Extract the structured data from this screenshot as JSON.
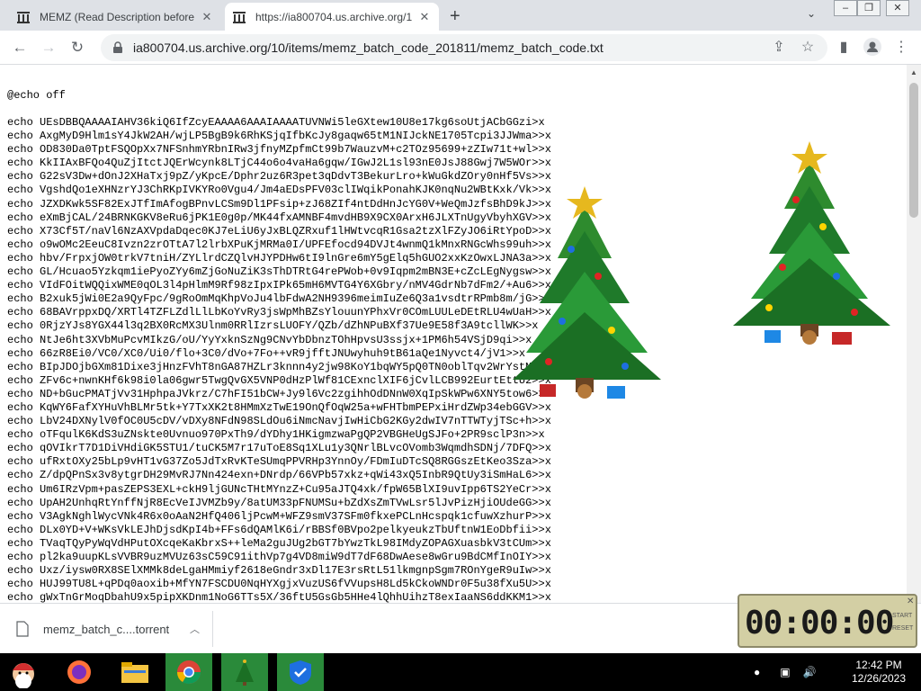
{
  "tabs": [
    {
      "title": "MEMZ (Read Description before",
      "icon": "archive-icon"
    },
    {
      "title": "https://ia800704.us.archive.org/1",
      "icon": "archive-icon"
    }
  ],
  "address_bar": {
    "url": "ia800704.us.archive.org/10/items/memz_batch_code_201811/memz_batch_code.txt"
  },
  "content": {
    "first_line": "@echo off",
    "lines": [
      "echo UEsDBBQAAAAIAHV36kiQ6IfZcyEAAAA6AAAIAAAATUVNWi5leGXtew10U8e17kg6soUtjACbGGzi>x",
      "echo AxgMyD9Hlm1sY4JkW2AH/wjLP5BgB9k6RhKSjqIfbKcJy8gaqw65tM1NIJckNE1705Tcpi3JJWma>>x",
      "echo OD830Da0TptFSQOpXx7NFSnhmYRbnIRw3jfnyMZpfmCt99b7WauzvM+c2TOz95699+zZIw71t+wl>>x",
      "echo KkIIAxBFQo4QuZjItctJQErWcynk8LTjC44o6o4vaHa6gqw/IGwJ2L1sl93nE0JsJ88Gwj7W5WOr>>x",
      "echo G22sV3Dw+dOnJ2XHaTxj9pZ/yKpcE/Dphr2uz6R3pet3qDdvT3BekurLro+kWuGkdZOry0nHf5Vs>>x",
      "echo VgshdQo1eXHNzrYJ3ChRKpIVKYRo0Vgu4/Jm4aEDsPFV03clIWqikPonahKJK0nqNu2WBtKxk/Vk>>x",
      "echo JZXDKwk5SF82ExJTfImAfogBPnvLCSm9Dl1PFsip+zJ68ZIf4ntDdHnJcYG0V+WeQmJzfsBhD9kJ>>x",
      "echo eXmBjCAL/24BRNKGKV8eRu6jPK1E0g0p/MK44fxAMNBF4mvdHB9X9CX0ArxH6JLXTnUgyVbyhXGV>>x",
      "echo X73Cf5T/naVl6NzAXVpdaDqec0KJ7eLiU6yJxBLQZRxuf1lHWtvcqR1Gsa2tzXlFZyJO6iRtYpoD>>x",
      "echo o9wOMc2EeuC8Ivzn2zrOTtA7l2lrbXPuKjMRMa0I/UPFEfocd94DVJt4wnmQ1kMnxRNGcWhs99uh>>x",
      "echo hbv/FrpxjOW0trkV7tniH/ZYLlrdCZQlvHJYPDHw6tI9lnGre6mY5gElq5hGUO2xxKzOwxLJNA3a>>x",
      "echo GL/Hcuao5Yzkqm1iePyoZYy6mZjGoNuZiK3sThDTRtG4rePWob+0v9Iqpm2mBN3E+cZcLEgNygsw>>x",
      "echo VIdFOitWQQixWME0qOL3l4pHlmM9Rf98zIpxIPk65mH6MVTG4Y6XGbry/nMV4GdrNb7dFm2/+Au6>>x",
      "echo B2xuk5jWi0E2a9QyFpc/9gRoOmMqKhpVoJu4lbFdwA2NH9396meimIuZe6Q3a1vsdtrRPmb8m/jG>>x",
      "echo 68BAVrppxDQ/XRTl4TZFLZdlLlLbKoYvRy3jsWpMhBZsYlouunYPhxVr0COmLUULeDEtRLU4wUaH>>x",
      "echo 0RjzYJs8YGX44l3q2BX0RcMX3Ulnm0RRlIzrsLUOFY/QZb/dZhNPuBXf37Ue9E58f3A9tcllWK>>x",
      "echo NtJe6ht3XVbMuPcvMIkzG/oU/YyYxknSzNg9CNvYbDbnzTOhHpvsU3ssjx+1PM6h54VSjD9qi>>x",
      "echo 66zR8Ei0/VC0/XC0/Ui0/flo+3C0/dVo+7Fo++vR9jfftJNUwyhuh9tB61aQe1Nyvct4/jV1>>x",
      "echo BIpJDOjbGXm81Dixe3jHnzFVhT8nGA87HZLr3knnn4y2jw98KoY1bqWY5pQ0TN0oblTqv2WrYstM>>x",
      "echo ZFv6c+nwnKHf6k98i0la06gwr5TwgQvGX5VNP0dHzPlWf81CExnclXIF6jCvlLCB992EurtEttU2>>x",
      "echo ND+bGucPMATjVv31HphpaJVkrz/C7hFI51bCW+Jy9l6Vc2zgihhOdDNnW0XqIpSkWPw6XNY5tow6>>x",
      "echo KqWY6FafXYHuVhBLMr5tk+Y7TxXK2t8HMmXzTwE19OnQfOqW25a+wFHTbmPEPxiHrdZWp34ebGGV>>x",
      "echo LbV24DXNylV0fOC0U5cDV/vDXy8NFdN98SLdOu6iNmcNavjIwHiCbG2KGy2dwIV7nTTWTyjTSc+h>>x",
      "echo oTFqulK6KdS3uZNskte0Uvnuo970PxTh9/dYDhy1HKigmzwaPgQP2VBGHeUgSJFo+2PR9sclP3n>>x",
      "echo qOVIkrT7D1DiVHdiGK5STU1/tuCK5M7r17uToE8Sq1XLu1y3QNrlBLvcOVomb3WqmdhSDNj/7DFQ>>x",
      "echo ufRxtOXy25bLp9vHT1vG37Zo5JdTxRvKTeSUmqPPVRHp3YnnOy/FDmIuDTcSQ8RGGszEtKeo3Sza>>x",
      "echo Z/dpQPnSx3v8ytgrDH29MvRJ7Nn424exn+DNrdp/66VPb57xkz+qWi43xQ5InbR9QtUy3iSmHaL6>>x",
      "echo Um6IRzVpm+pasZEPS3EXL+ckH9ljGUNcTHtMYnzZ+Cu95aJTQ4xk/fpW65BlXI9uvIpp6TS2YeCr>>x",
      "echo UpAH2UnhqRtYnffNjR8EcVeIJVMZb9y/8atUM33pFNUMSu+bZdXsZmTVwLsr5lJvPizHjiOUdeGG>>x",
      "echo V3AgkNghlWycVNk4R6x0oAaN2HfQ406ljPcwM+WFZ9smV37SFm0fkxePCLnHcspqk1cfuwXzhurP>>x",
      "echo DLx0YD+V+WKsVkLEJhDjsdKpI4b+FFs6dQAMlK6i/rBBSf0BVpo2pelkyeukzTbUftnW1EoDbfii>>x",
      "echo TVaqTQyPyWqVdHPutOXcqeKaKbrxS++leMa2guJUg2bGT7bYwzTkL98IMdyZOPAGXuasbkV3tCUm>>x",
      "echo pl2ka9uupKLsVVBR9uzMVUz63sC59C91ithVp7g4VD8miW9dT7dF68DwAese8wGru9BdCMfInOIY>>x",
      "echo Uxz/iysw0RX8SElXMMk8deLgaHMmiyf2618eGndr3xDl17E3rsRtL51lkmgnpSgm7ROnYgeR9uIw>>x",
      "echo HUJ99TU8L+qPDq0aoxib+MfYN7FSCDU0NqHYXgjxVuzUS6fVVupsH8Ld5kCkoWNDr0F5u38fXu5U>>x",
      "echo gWxTnGrMoqDbahU9x5pipXKDnm1NoG6TTs5X/36ftU5GsGb5HHe4lQhhUihzT8exIaaNS6ddKKM1>>x"
    ]
  },
  "download": {
    "filename": "memz_batch_c....torrent"
  },
  "timer": {
    "display": "00:00:00",
    "label1": "START",
    "label2": "RESET"
  },
  "taskbar": {
    "apps": [
      "santa-icon",
      "firefox-icon",
      "file-explorer-icon",
      "chrome-icon",
      "christmas-tree-icon",
      "shield-icon"
    ],
    "clock_time": "12:42 PM",
    "clock_date": "12/26/2023"
  },
  "colors": {
    "accent": "#1a73e8",
    "taskbar": "#000000",
    "timer_bg": "#d3cfa4"
  }
}
